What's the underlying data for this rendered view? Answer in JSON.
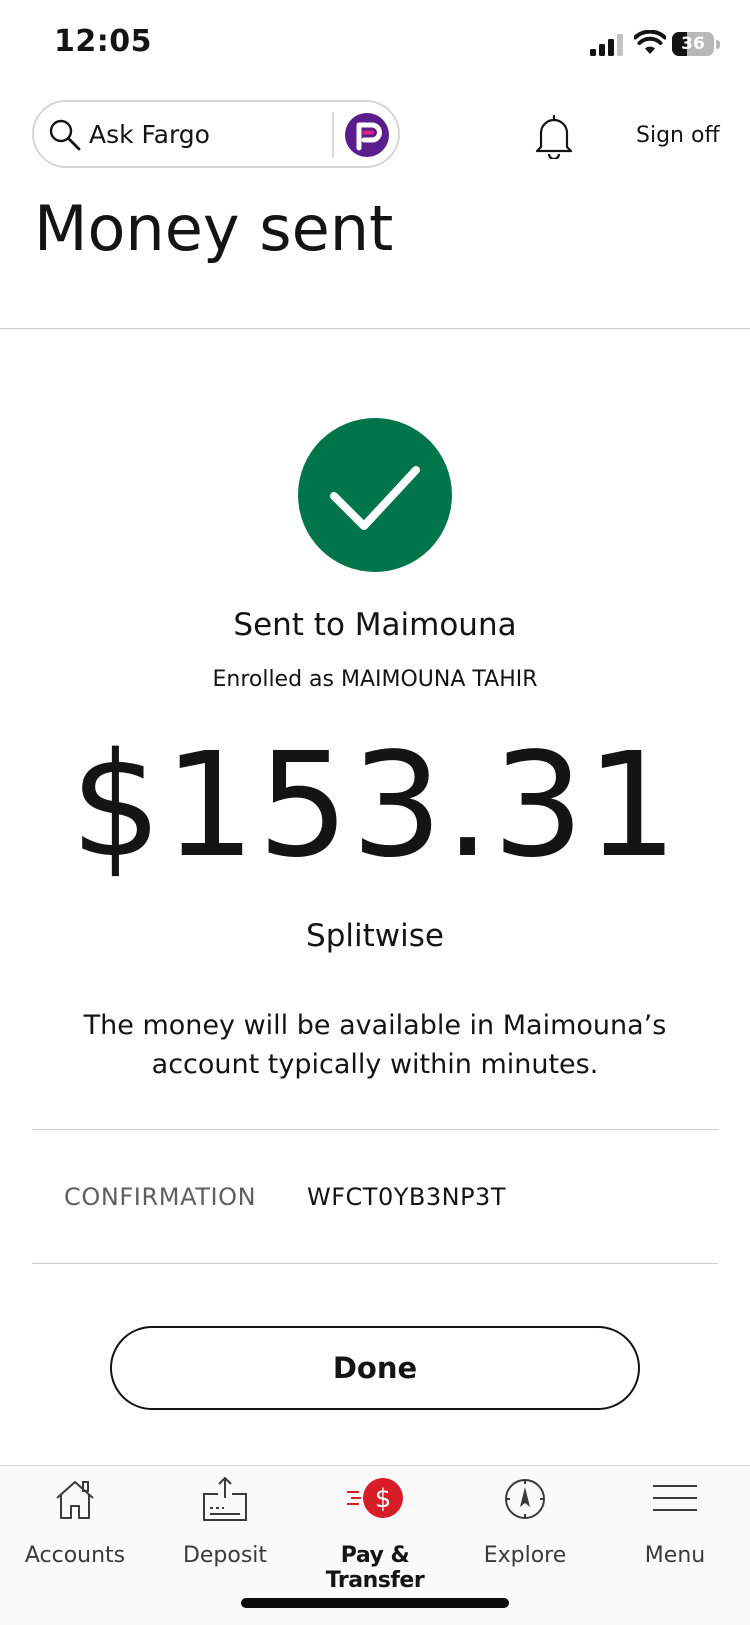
{
  "status_bar": {
    "time": "12:05",
    "battery": "36",
    "battery_level": 0.36
  },
  "header": {
    "search_placeholder": "Ask Fargo",
    "sign_off_label": "Sign off"
  },
  "page": {
    "title": "Money sent"
  },
  "confirmation": {
    "recipient_line": "Sent to Maimouna",
    "enrolled_line": "Enrolled as MAIMOUNA TAHIR",
    "amount": "$153.31",
    "memo": "Splitwise",
    "availability_note": "The money will be available in Maimouna’s account typically within minutes.",
    "confirmation_label": "CONFIRMATION",
    "confirmation_number": "WFCT0YB3NP3T",
    "done_label": "Done"
  },
  "tab_bar": {
    "items": [
      {
        "label": "Accounts",
        "icon": "home-icon"
      },
      {
        "label": "Deposit",
        "icon": "deposit-icon"
      },
      {
        "label": "Pay & Transfer",
        "icon": "pay-transfer-icon",
        "active": true
      },
      {
        "label": "Explore",
        "icon": "compass-icon"
      },
      {
        "label": "Menu",
        "icon": "hamburger-menu-icon"
      }
    ]
  },
  "colors": {
    "success_green": "#00754a",
    "brand_red": "#d71e28",
    "fargo_purple": "#5a1e8c",
    "text": "#141414",
    "muted_text": "#5f5f5f",
    "divider": "#cfcfcf"
  }
}
